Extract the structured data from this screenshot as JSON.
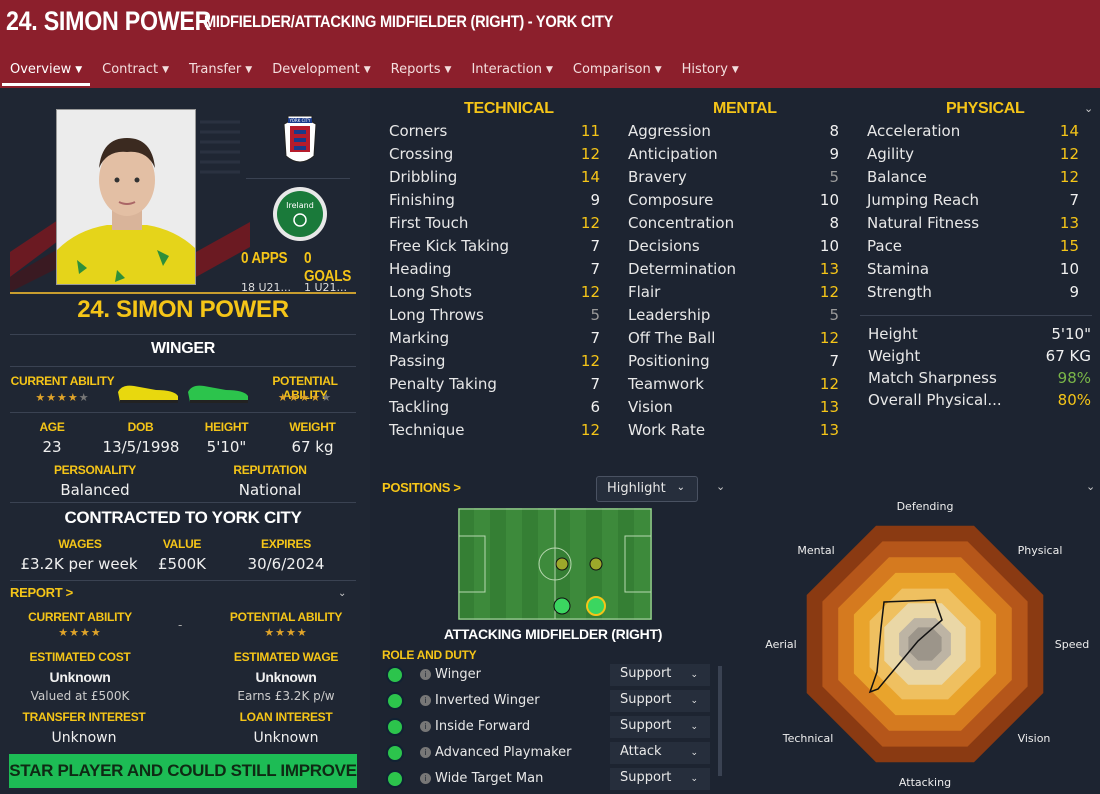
{
  "header": {
    "title": "24. SIMON POWER",
    "subtitle": "MIDFIELDER/ATTACKING MIDFIELDER (RIGHT) - YORK CITY",
    "tabs": [
      "Overview",
      "Contract",
      "Transfer",
      "Development",
      "Reports",
      "Interaction",
      "Comparison",
      "History"
    ]
  },
  "profile": {
    "apps": "0 APPS",
    "goals": "0 GOALS",
    "apps_sub": "18 U21...",
    "goals_sub": "1 U21...",
    "name": "24. SIMON POWER",
    "role": "WINGER",
    "current_ability_label": "CURRENT ABILITY",
    "potential_ability_label": "POTENTIAL ABILITY",
    "current_ability_stars": 3.5,
    "potential_ability_stars": 3.5,
    "labels": {
      "age": "AGE",
      "dob": "DOB",
      "height": "HEIGHT",
      "weight": "WEIGHT",
      "personality": "PERSONALITY",
      "reputation": "REPUTATION"
    },
    "age": "23",
    "dob": "13/5/1998",
    "height": "5'10\"",
    "weight": "67 kg",
    "personality": "Balanced",
    "reputation": "National",
    "contract_title": "CONTRACTED TO YORK CITY",
    "contract_labels": {
      "wages": "WAGES",
      "value": "VALUE",
      "expires": "EXPIRES"
    },
    "wages": "£3.2K per week",
    "value": "£500K",
    "expires": "30/6/2024",
    "club_badge_text": "YORK CITY",
    "nation_badge_text": "Ireland"
  },
  "report": {
    "title": "REPORT >",
    "current_ability_label": "CURRENT ABILITY",
    "potential_ability_label": "POTENTIAL ABILITY",
    "dash": "-",
    "estimated_cost_label": "ESTIMATED COST",
    "estimated_cost": "Unknown",
    "estimated_cost_sub": "Valued at £500K",
    "estimated_wage_label": "ESTIMATED WAGE",
    "estimated_wage": "Unknown",
    "estimated_wage_sub": "Earns £3.2K p/w",
    "transfer_interest_label": "TRANSFER INTEREST",
    "transfer_interest": "Unknown",
    "loan_interest_label": "LOAN INTEREST",
    "loan_interest": "Unknown",
    "banner": "STAR PLAYER AND COULD STILL IMPROVE"
  },
  "attributes": {
    "technical_title": "TECHNICAL",
    "mental_title": "MENTAL",
    "physical_title": "PHYSICAL",
    "technical": [
      {
        "name": "Corners",
        "value": "11",
        "tone": "y"
      },
      {
        "name": "Crossing",
        "value": "12",
        "tone": "y"
      },
      {
        "name": "Dribbling",
        "value": "14",
        "tone": "y"
      },
      {
        "name": "Finishing",
        "value": "9",
        "tone": "w"
      },
      {
        "name": "First Touch",
        "value": "12",
        "tone": "y"
      },
      {
        "name": "Free Kick Taking",
        "value": "7",
        "tone": "w"
      },
      {
        "name": "Heading",
        "value": "7",
        "tone": "w"
      },
      {
        "name": "Long Shots",
        "value": "12",
        "tone": "y"
      },
      {
        "name": "Long Throws",
        "value": "5",
        "tone": "g"
      },
      {
        "name": "Marking",
        "value": "7",
        "tone": "w"
      },
      {
        "name": "Passing",
        "value": "12",
        "tone": "y"
      },
      {
        "name": "Penalty Taking",
        "value": "7",
        "tone": "w"
      },
      {
        "name": "Tackling",
        "value": "6",
        "tone": "w"
      },
      {
        "name": "Technique",
        "value": "12",
        "tone": "y"
      }
    ],
    "mental": [
      {
        "name": "Aggression",
        "value": "8",
        "tone": "w"
      },
      {
        "name": "Anticipation",
        "value": "9",
        "tone": "w"
      },
      {
        "name": "Bravery",
        "value": "5",
        "tone": "g"
      },
      {
        "name": "Composure",
        "value": "10",
        "tone": "w"
      },
      {
        "name": "Concentration",
        "value": "8",
        "tone": "w"
      },
      {
        "name": "Decisions",
        "value": "10",
        "tone": "w"
      },
      {
        "name": "Determination",
        "value": "13",
        "tone": "y"
      },
      {
        "name": "Flair",
        "value": "12",
        "tone": "y"
      },
      {
        "name": "Leadership",
        "value": "5",
        "tone": "g"
      },
      {
        "name": "Off The Ball",
        "value": "12",
        "tone": "y"
      },
      {
        "name": "Positioning",
        "value": "7",
        "tone": "w"
      },
      {
        "name": "Teamwork",
        "value": "12",
        "tone": "y"
      },
      {
        "name": "Vision",
        "value": "13",
        "tone": "y"
      },
      {
        "name": "Work Rate",
        "value": "13",
        "tone": "y"
      }
    ],
    "physical": [
      {
        "name": "Acceleration",
        "value": "14",
        "tone": "y"
      },
      {
        "name": "Agility",
        "value": "12",
        "tone": "y"
      },
      {
        "name": "Balance",
        "value": "12",
        "tone": "y"
      },
      {
        "name": "Jumping Reach",
        "value": "7",
        "tone": "w"
      },
      {
        "name": "Natural Fitness",
        "value": "13",
        "tone": "y"
      },
      {
        "name": "Pace",
        "value": "15",
        "tone": "y"
      },
      {
        "name": "Stamina",
        "value": "10",
        "tone": "w"
      },
      {
        "name": "Strength",
        "value": "9",
        "tone": "w"
      }
    ],
    "physical_extra": [
      {
        "name": "Height",
        "value": "5'10\"",
        "tone": "w"
      },
      {
        "name": "Weight",
        "value": "67 KG",
        "tone": "w"
      },
      {
        "name": "Match Sharpness",
        "value": "98%",
        "tone": "gr"
      },
      {
        "name": "Overall Physical...",
        "value": "80%",
        "tone": "y"
      }
    ]
  },
  "positions": {
    "title": "POSITIONS >",
    "highlight_label": "Highlight",
    "position_name": "ATTACKING MIDFIELDER (RIGHT)",
    "role_duty_title": "ROLE AND DUTY",
    "roles": [
      {
        "name": "Winger",
        "duty": "Support"
      },
      {
        "name": "Inverted Winger",
        "duty": "Support"
      },
      {
        "name": "Inside Forward",
        "duty": "Support"
      },
      {
        "name": "Advanced Playmaker",
        "duty": "Attack"
      },
      {
        "name": "Wide Target Man",
        "duty": "Support"
      }
    ]
  },
  "spider": {
    "labels": [
      "Defending",
      "Physical",
      "Speed",
      "Vision",
      "Attacking",
      "Technical",
      "Aerial",
      "Mental"
    ]
  },
  "colors": {
    "header": "#8c1f2c",
    "accent": "#f5c518",
    "banner": "#1dbc55"
  }
}
